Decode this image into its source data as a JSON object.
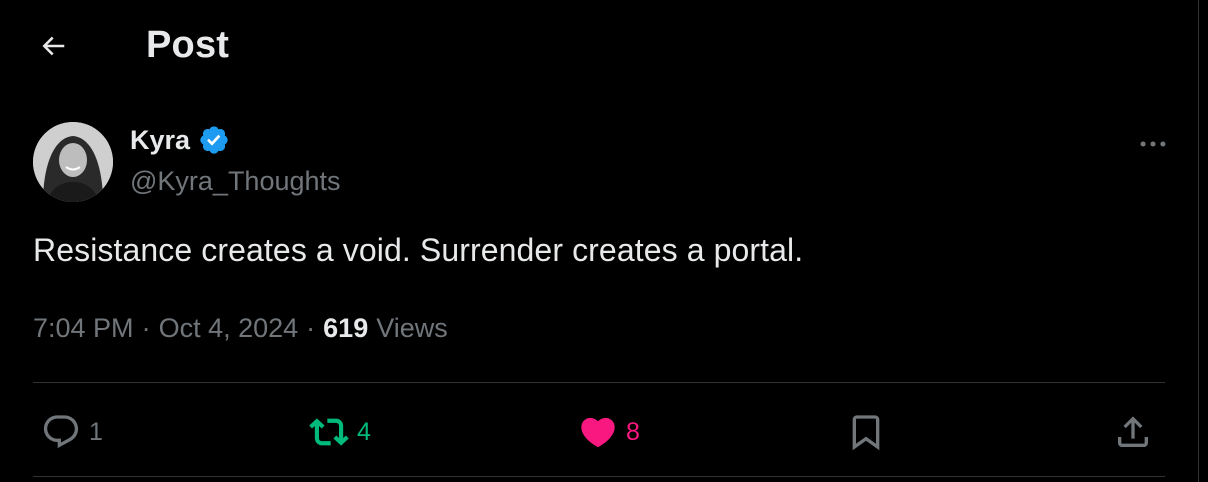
{
  "header": {
    "title": "Post"
  },
  "author": {
    "display_name": "Kyra",
    "handle": "@Kyra_Thoughts",
    "verified": true
  },
  "post": {
    "text": "Resistance creates a void. Surrender creates a portal.",
    "time": "7:04 PM",
    "date": "Oct 4, 2024",
    "separator": "·",
    "views_count": "619",
    "views_label": "Views"
  },
  "actions": {
    "reply_count": "1",
    "repost_count": "4",
    "like_count": "8"
  },
  "icons": {
    "back": "arrow-left-icon",
    "verified": "verified-badge-icon",
    "more": "more-horizontal-icon",
    "reply": "reply-icon",
    "repost": "repost-icon",
    "like": "heart-icon",
    "bookmark": "bookmark-icon",
    "share": "share-icon"
  },
  "colors": {
    "background": "#000000",
    "text": "#e7e9ea",
    "muted": "#71767b",
    "verified": "#1d9bf0",
    "repost": "#00ba7c",
    "like": "#f91880",
    "divider": "#2f3336"
  }
}
